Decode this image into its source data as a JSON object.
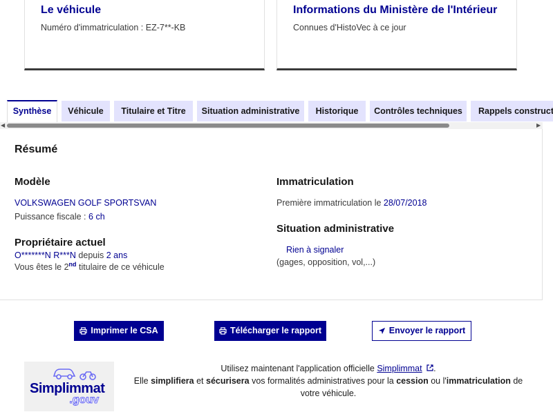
{
  "cards": [
    {
      "title": "Le véhicule",
      "desc": "Numéro d'immatriculation : EZ-7**-KB"
    },
    {
      "title": "Informations du Ministère de l'Intérieur",
      "desc": "Connues d'HistoVec à ce jour"
    }
  ],
  "tabs": [
    "Synthèse",
    "Véhicule",
    "Titulaire et Titre",
    "Situation administrative",
    "Historique",
    "Contrôles techniques",
    "Rappels constructeur"
  ],
  "active_tab": "Synthèse",
  "summary": {
    "title": "Résumé",
    "modele": {
      "heading": "Modèle",
      "name": "VOLKSWAGEN GOLF SPORTSVAN",
      "puissance_label": "Puissance fiscale :",
      "puissance_value": "6 ch"
    },
    "proprietaire": {
      "heading": "Propriétaire actuel",
      "name": "O*******N R***N",
      "depuis": "depuis",
      "duration": "2 ans",
      "titulaire_pre": "Vous êtes le 2",
      "titulaire_sup": "nd",
      "titulaire_post": "titulaire de ce véhicule"
    },
    "immatriculation": {
      "heading": "Immatriculation",
      "label": "Première immatriculation le",
      "date": "28/07/2018"
    },
    "situation": {
      "heading": "Situation administrative",
      "status": "Rien à signaler",
      "detail": "(gages, opposition, vol,...)"
    }
  },
  "buttons": {
    "print": "Imprimer le CSA",
    "download": "Télécharger le rapport",
    "send": "Envoyer le rapport"
  },
  "footer": {
    "logo_name": "Simplimmat",
    "logo_sub": ".gouv",
    "line1_pre": "Utilisez maintenant l'application officielle",
    "line1_link": "Simplimmat",
    "line2_a": "Elle",
    "line2_b": "simplifiera",
    "line2_c": "et",
    "line2_d": "sécurisera",
    "line2_e": "vos formalités administratives pour la",
    "line2_f": "cession",
    "line2_g": "ou l'",
    "line2_h": "immatriculation",
    "line2_i": "de votre véhicule."
  },
  "colors": {
    "primary": "#000091",
    "tab_bg": "#e3e3fd",
    "text": "#3a3a3a"
  },
  "icons": [
    "printer-icon",
    "send-icon",
    "external-link-icon",
    "car-icon",
    "motorbike-icon"
  ]
}
